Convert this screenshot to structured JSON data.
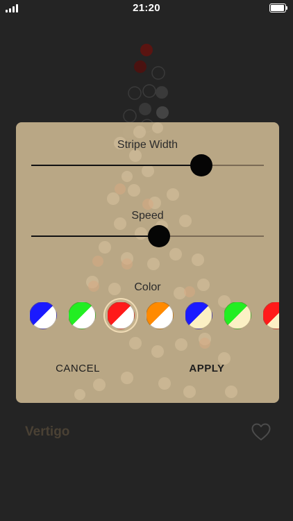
{
  "status_bar": {
    "time": "21:20",
    "signal_icon": "signal-bars-icon",
    "battery_icon": "battery-icon"
  },
  "dialog": {
    "stripe_width": {
      "label": "Stripe Width",
      "value_fraction": 0.73
    },
    "speed": {
      "label": "Speed",
      "value_fraction": 0.55
    },
    "color": {
      "label": "Color",
      "options": [
        {
          "primary": "#1a1aff",
          "secondary": "#ffffff"
        },
        {
          "primary": "#22ee22",
          "secondary": "#ffffff"
        },
        {
          "primary": "#ff1a1a",
          "secondary": "#ffffff",
          "selected": true
        },
        {
          "primary": "#ff8a00",
          "secondary": "#ffffff"
        },
        {
          "primary": "#1a1aff",
          "secondary": "#fbf0c4"
        },
        {
          "primary": "#22ee22",
          "secondary": "#fbf0c4"
        },
        {
          "primary": "#ff1a1a",
          "secondary": "#fbf0c4"
        }
      ]
    },
    "cancel_label": "CANCEL",
    "apply_label": "APPLY"
  },
  "footer": {
    "title": "Vertigo",
    "favorite_icon": "heart-outline-icon"
  },
  "colors": {
    "background": "#242424",
    "dialog": "#c5b28d",
    "accent_dot_red": "#7a1a16"
  }
}
